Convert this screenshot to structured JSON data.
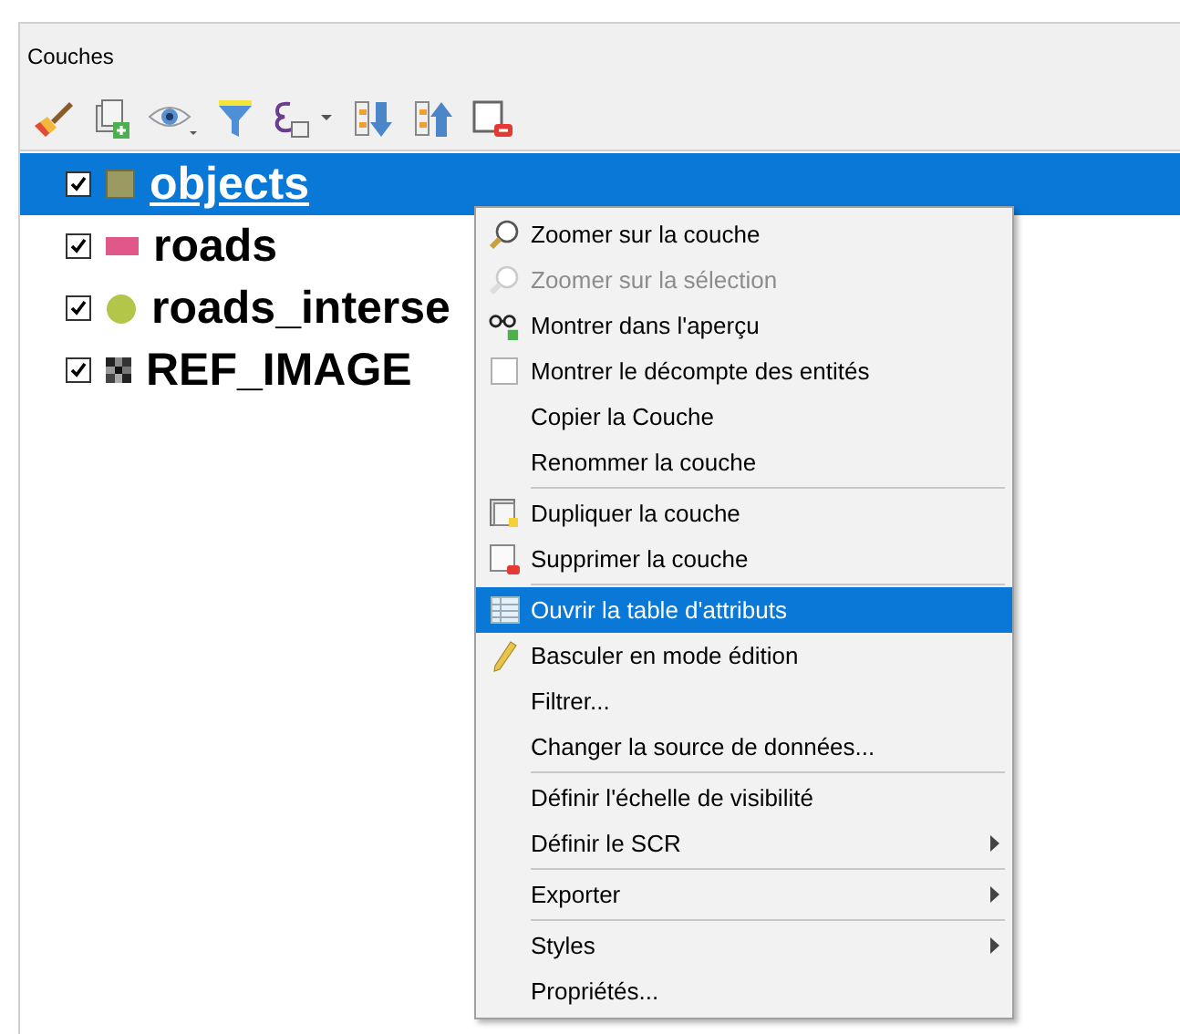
{
  "panel": {
    "title": "Couches"
  },
  "layers": [
    {
      "name": "objects",
      "checked": true,
      "selected": true
    },
    {
      "name": "roads",
      "checked": true,
      "selected": false
    },
    {
      "name": "roads_interse",
      "checked": true,
      "selected": false
    },
    {
      "name": "REF_IMAGE",
      "checked": true,
      "selected": false
    }
  ],
  "menu": [
    {
      "kind": "item",
      "label": "Zoomer sur la couche",
      "disabled": false,
      "selected": false
    },
    {
      "kind": "item",
      "label": "Zoomer sur la sélection",
      "disabled": true,
      "selected": false
    },
    {
      "kind": "item",
      "label": "Montrer dans l'aperçu",
      "disabled": false,
      "selected": false
    },
    {
      "kind": "check",
      "label": "Montrer le décompte des entités",
      "checked": false,
      "disabled": false,
      "selected": false
    },
    {
      "kind": "item",
      "label": "Copier la Couche",
      "disabled": false,
      "selected": false
    },
    {
      "kind": "item",
      "label": "Renommer la couche",
      "disabled": false,
      "selected": false
    },
    {
      "kind": "separator"
    },
    {
      "kind": "item",
      "label": "Dupliquer la couche",
      "disabled": false,
      "selected": false
    },
    {
      "kind": "item",
      "label": "Supprimer la couche",
      "disabled": false,
      "selected": false
    },
    {
      "kind": "separator"
    },
    {
      "kind": "item",
      "label": "Ouvrir la table d'attributs",
      "disabled": false,
      "selected": true
    },
    {
      "kind": "item",
      "label": "Basculer en mode édition",
      "disabled": false,
      "selected": false
    },
    {
      "kind": "item",
      "label": "Filtrer...",
      "disabled": false,
      "selected": false
    },
    {
      "kind": "item",
      "label": "Changer la source de données...",
      "disabled": false,
      "selected": false
    },
    {
      "kind": "separator"
    },
    {
      "kind": "item",
      "label": "Définir l'échelle de visibilité",
      "disabled": false,
      "selected": false
    },
    {
      "kind": "submenu",
      "label": "Définir le SCR",
      "disabled": false,
      "selected": false
    },
    {
      "kind": "separator"
    },
    {
      "kind": "submenu",
      "label": "Exporter",
      "disabled": false,
      "selected": false
    },
    {
      "kind": "separator"
    },
    {
      "kind": "submenu",
      "label": "Styles",
      "disabled": false,
      "selected": false
    },
    {
      "kind": "item",
      "label": "Propriétés...",
      "disabled": false,
      "selected": false
    }
  ]
}
